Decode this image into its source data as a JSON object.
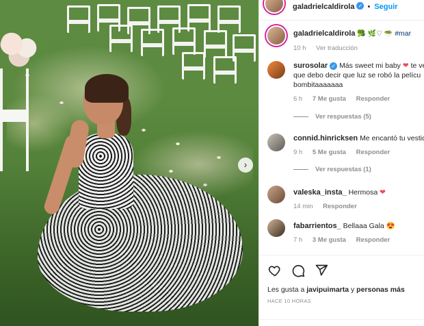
{
  "post": {
    "author": "galadrielcaldirola",
    "follow_label": "Seguir",
    "dot": "•"
  },
  "caption": {
    "author": "galadrielcaldirola",
    "text": "🥦 🌿♡ 🥗",
    "hashtag": "#mar",
    "time": "10 h",
    "see_translation": "Ver traducción"
  },
  "comments": [
    {
      "user": "surosolar",
      "verified": true,
      "text_line1": "Más sweet mi baby",
      "heart": "❤",
      "text_line1_end": "te ve",
      "text_line2": "que debo decir que luz se robó la pelícu",
      "text_line3": "bombitaaaaaaa",
      "time": "6 h",
      "likes": "7 Me gusta",
      "reply": "Responder",
      "view_replies": "Ver respuestas (5)"
    },
    {
      "user": "connid.hinricksen",
      "text": "Me encantó tu vestido",
      "time": "9 h",
      "likes": "5 Me gusta",
      "reply": "Responder",
      "view_replies": "Ver respuestas (1)"
    },
    {
      "user": "valeska_insta_",
      "text": "Hermosa",
      "heart": "❤",
      "time": "14 min",
      "reply": "Responder"
    },
    {
      "user": "fabarrientos_",
      "text": "Bellaaa Gala",
      "emoji": "😍",
      "time": "7 h",
      "likes": "3 Me gusta",
      "reply": "Responder"
    }
  ],
  "footer": {
    "likes_prefix": "Les gusta a",
    "liker": "javipuimarta",
    "and": "y",
    "others": "personas más",
    "time_ago": "HACE 10 HORAS"
  },
  "colors": {
    "accent": "#0095f6",
    "verified": "#3897f0",
    "heart": "#ed4956",
    "muted": "#8e8e8e"
  },
  "icons": {
    "like": "heart-icon",
    "comment": "comment-icon",
    "share": "share-icon",
    "next": "chevron-right-icon"
  }
}
